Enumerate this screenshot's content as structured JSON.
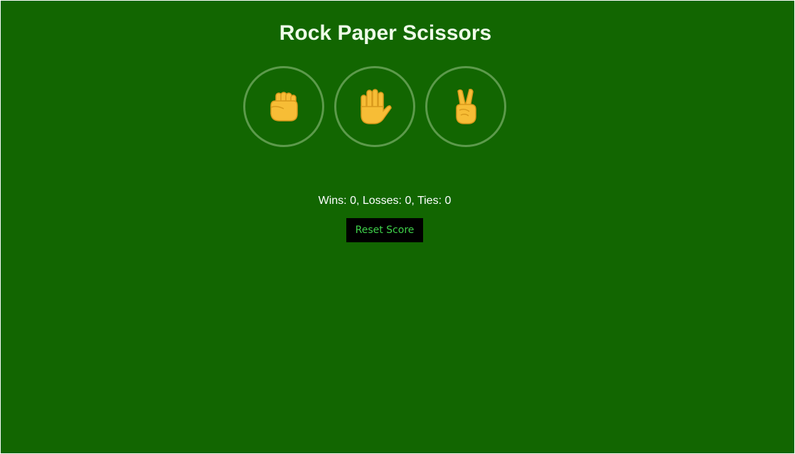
{
  "title": "Rock Paper Scissors",
  "moves": [
    {
      "name": "rock",
      "icon": "raised-fist-icon"
    },
    {
      "name": "paper",
      "icon": "raised-hand-icon"
    },
    {
      "name": "scissors",
      "icon": "victory-hand-icon"
    }
  ],
  "score_text": "Wins: 0, Losses: 0, Ties: 0",
  "score": {
    "wins": 0,
    "losses": 0,
    "ties": 0
  },
  "reset_label": "Reset Score",
  "colors": {
    "background": "#126601",
    "title": "#eefbe8",
    "ring": "#5c9a4b",
    "emoji": "#f7bd36",
    "reset_bg": "#000000",
    "reset_text": "#3fd24a"
  }
}
